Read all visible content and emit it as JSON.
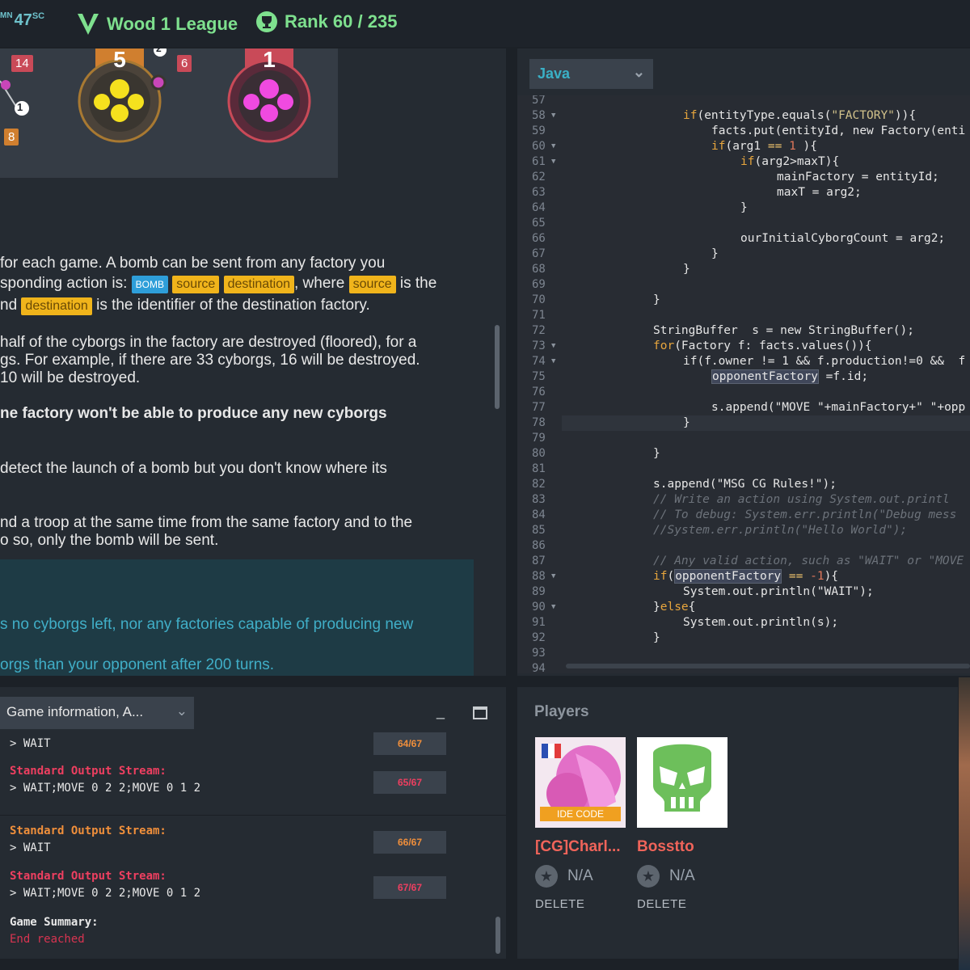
{
  "topbar": {
    "score_prefix": "MN",
    "score": "47",
    "score_suffix": "SC",
    "league": "Wood 1 League",
    "rank": "Rank 60 / 235"
  },
  "game_view": {
    "badges": [
      "14",
      "6",
      "8"
    ],
    "factory_counts": [
      "5",
      "1"
    ],
    "troop_label": "1",
    "troop_label2": "2"
  },
  "statement": {
    "line1": "for each game. A bomb can be sent from any factory you",
    "line2_pre": "sponding action is: ",
    "tag_bomb": "BOMB",
    "tag_source": "source",
    "tag_destination": "destination",
    "line2_mid": ", where ",
    "line2_post": " is the",
    "line3_pre": "nd ",
    "line3_post": " is the identifier of the destination factory.",
    "line4": "half of the cyborgs in the factory are destroyed (floored), for a",
    "line5": "gs. For example, if there are 33 cyborgs, 16 will be destroyed.",
    "line6": "10 will be destroyed.",
    "line7": "ne factory won't be able to produce any new cyborgs",
    "line8": "detect the launch of a bomb but you don't know where its",
    "line9": "nd a troop at the same time from the same factory and to the",
    "line10": "o so, only the bomb will be sent.",
    "teal1": "s no cyborgs left, nor any factories capable of producing new",
    "teal2": "orgs than your opponent after 200 turns."
  },
  "editor": {
    "language": "Java",
    "lines": [
      {
        "n": "57",
        "fold": false
      },
      {
        "n": "58",
        "fold": true
      },
      {
        "n": "59",
        "fold": false
      },
      {
        "n": "60",
        "fold": true
      },
      {
        "n": "61",
        "fold": true
      },
      {
        "n": "62",
        "fold": false
      },
      {
        "n": "63",
        "fold": false
      },
      {
        "n": "64",
        "fold": false
      },
      {
        "n": "65",
        "fold": false
      },
      {
        "n": "66",
        "fold": false
      },
      {
        "n": "67",
        "fold": false
      },
      {
        "n": "68",
        "fold": false
      },
      {
        "n": "69",
        "fold": false
      },
      {
        "n": "70",
        "fold": false
      },
      {
        "n": "71",
        "fold": false
      },
      {
        "n": "72",
        "fold": false
      },
      {
        "n": "73",
        "fold": true
      },
      {
        "n": "74",
        "fold": true
      },
      {
        "n": "75",
        "fold": false
      },
      {
        "n": "76",
        "fold": false
      },
      {
        "n": "77",
        "fold": false
      },
      {
        "n": "78",
        "fold": false
      },
      {
        "n": "79",
        "fold": false
      },
      {
        "n": "80",
        "fold": false
      },
      {
        "n": "81",
        "fold": false
      },
      {
        "n": "82",
        "fold": false
      },
      {
        "n": "83",
        "fold": false
      },
      {
        "n": "84",
        "fold": false
      },
      {
        "n": "85",
        "fold": false
      },
      {
        "n": "86",
        "fold": false
      },
      {
        "n": "87",
        "fold": false
      },
      {
        "n": "88",
        "fold": true
      },
      {
        "n": "89",
        "fold": false
      },
      {
        "n": "90",
        "fold": true
      },
      {
        "n": "91",
        "fold": false
      },
      {
        "n": "92",
        "fold": false
      },
      {
        "n": "93",
        "fold": false
      },
      {
        "n": "94",
        "fold": false
      }
    ],
    "code": {
      "l58": "if(entityType.equals(\"FACTORY\")){",
      "l59": "facts.put(entityId, new Factory(enti",
      "l60": "if(arg1 == 1 ){",
      "l61": "if(arg2>maxT){",
      "l62": "mainFactory = entityId;",
      "l63": "maxT = arg2;",
      "l64": "}",
      "l66": "ourInitialCyborgCount = arg2;",
      "l67": "}",
      "l68": "}",
      "l70": "}",
      "l72": "StringBuffer  s = new StringBuffer();",
      "l73": "for(Factory f: facts.values()){",
      "l74": "if(f.owner != 1 && f.production!=0 &&  f",
      "l75": "opponentFactory =f.id;",
      "l77": "s.append(\"MOVE \"+mainFactory+\" \"+opp",
      "l78": "}",
      "l80": "}",
      "l82": "s.append(\"MSG CG Rules!\");",
      "l83": "// Write an action using System.out.printl",
      "l84": "// To debug: System.err.println(\"Debug mess",
      "l85": "//System.err.println(\"Hello World\");",
      "l87": "// Any valid action, such as \"WAIT\" or \"MOVE",
      "l88": "if(opponentFactory == -1){",
      "l89": "System.out.println(\"WAIT\");",
      "l90": "}else{",
      "l91": "System.out.println(s);",
      "l92": "}"
    }
  },
  "console": {
    "select_label": "Game information, A...",
    "entries": [
      {
        "header": "",
        "output": "> WAIT",
        "frame": "64/67"
      },
      {
        "header": "Standard Output Stream:",
        "output": "> WAIT;MOVE 0 2 2;MOVE 0 1 2",
        "frame": "65/67"
      },
      {
        "header": "Standard Output Stream:",
        "output": "> WAIT",
        "frame": "66/67"
      },
      {
        "header": "Standard Output Stream:",
        "output": "> WAIT;MOVE 0 2 2;MOVE 0 1 2",
        "frame": "67/67"
      }
    ],
    "summary_label": "Game Summary:",
    "summary_value": "End reached"
  },
  "players": {
    "title": "Players",
    "list": [
      {
        "name": "[CG]Charl...",
        "rank": "N/A",
        "delete": "DELETE",
        "banner": "IDE CODE"
      },
      {
        "name": "Bosstto",
        "rank": "N/A",
        "delete": "DELETE"
      }
    ]
  },
  "colors": {
    "accent_green": "#7ee08e",
    "accent_cyan": "#3ab0c6",
    "player_red": "#f0645a",
    "stream_red": "#ee3f60",
    "stream_orange": "#f08f3b"
  }
}
